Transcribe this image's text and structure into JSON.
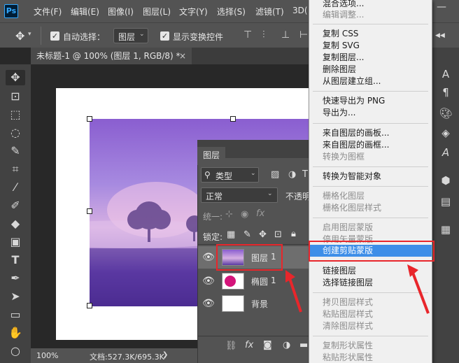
{
  "menubar": {
    "logo": "Ps",
    "items": [
      "文件(F)",
      "编辑(E)",
      "图像(I)",
      "图层(L)",
      "文字(Y)",
      "选择(S)",
      "滤镜(T)",
      "3D("
    ]
  },
  "options": {
    "auto_select_label": "自动选择：",
    "auto_select_value": "图层",
    "show_transform_label": "显示变换控件"
  },
  "document": {
    "tab_title": "未标题-1 @ 100% (图层 1, RGB/8) *",
    "tab_close": "×"
  },
  "status": {
    "zoom": "100%",
    "doc_size": "文档:527.3K/695.3K"
  },
  "layers_panel": {
    "tab_label": "图层",
    "filter_kind": "类型",
    "blend_mode": "正常",
    "opacity_label": "不透明",
    "unify_label": "统一:",
    "lock_label": "锁定:",
    "layers": [
      {
        "name": "图层",
        "suffix": "1",
        "thumb": "photo"
      },
      {
        "name": "椭圆",
        "suffix": "1",
        "thumb": "ellipse"
      },
      {
        "name": "背景",
        "suffix": "",
        "thumb": "white"
      }
    ]
  },
  "context_menu": {
    "groups": [
      [
        {
          "label": "混合选项...",
          "enabled": true
        },
        {
          "label": "编辑调整...",
          "enabled": false
        }
      ],
      [
        {
          "label": "复制 CSS",
          "enabled": true
        },
        {
          "label": "复制 SVG",
          "enabled": true
        },
        {
          "label": "复制图层...",
          "enabled": true
        },
        {
          "label": "删除图层",
          "enabled": true
        },
        {
          "label": "从图层建立组...",
          "enabled": true
        }
      ],
      [
        {
          "label": "快速导出为 PNG",
          "enabled": true
        },
        {
          "label": "导出为...",
          "enabled": true
        }
      ],
      [
        {
          "label": "来自图层的画板...",
          "enabled": true
        },
        {
          "label": "来自图层的画框...",
          "enabled": true
        },
        {
          "label": "转换为图框",
          "enabled": false
        }
      ],
      [
        {
          "label": "转换为智能对象",
          "enabled": true
        }
      ],
      [
        {
          "label": "栅格化图层",
          "enabled": false
        },
        {
          "label": "栅格化图层样式",
          "enabled": false
        }
      ],
      [
        {
          "label": "启用图层蒙版",
          "enabled": false
        },
        {
          "label": "停用矢量蒙版",
          "enabled": false
        },
        {
          "label": "创建剪贴蒙版",
          "enabled": true,
          "highlighted": true
        }
      ],
      [
        {
          "label": "链接图层",
          "enabled": true
        },
        {
          "label": "选择链接图层",
          "enabled": true
        }
      ],
      [
        {
          "label": "拷贝图层样式",
          "enabled": false
        },
        {
          "label": "粘贴图层样式",
          "enabled": false
        },
        {
          "label": "清除图层样式",
          "enabled": false
        }
      ],
      [
        {
          "label": "复制形状属性",
          "enabled": false
        },
        {
          "label": "粘贴形状属性",
          "enabled": false
        }
      ]
    ]
  },
  "colors": {
    "highlight": "#3d8ee8",
    "annotation_red": "#e8262b",
    "menubar": "#535353",
    "panel": "#535353"
  },
  "icons": [
    "move-icon",
    "artboard-icon",
    "marquee-icon",
    "lasso-icon",
    "quick-select-icon",
    "crop-icon",
    "eyedropper-icon",
    "brush-icon",
    "eraser-icon",
    "gradient-icon",
    "type-icon",
    "pen-icon",
    "path-select-icon",
    "rectangle-icon",
    "ellipse-icon",
    "eye-icon",
    "lock-icon",
    "fx-icon",
    "link-icon",
    "mask-icon",
    "new-layer-icon",
    "search-icon"
  ]
}
